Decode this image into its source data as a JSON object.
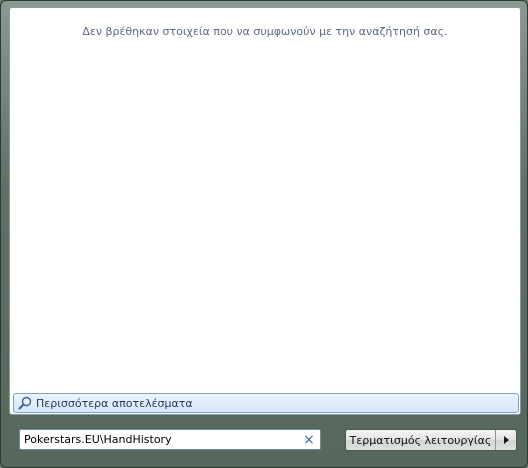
{
  "results": {
    "no_results_text": "Δεν βρέθηκαν στοιχεία που να συμφωνούν με την αναζήτησή σας.",
    "more_results_label": "Περισσότερα αποτελέσματα",
    "more_results_icon": "search-icon"
  },
  "search": {
    "value": "Pokerstars.EU\\HandHistory",
    "clear_icon": "close-icon",
    "clear_glyph": "×"
  },
  "power": {
    "shutdown_label": "Τερματισμός λειτουργίας",
    "options_icon": "chevron-right-icon"
  },
  "colors": {
    "accent": "#7da2ce",
    "text_muted": "#5b6a7c"
  }
}
